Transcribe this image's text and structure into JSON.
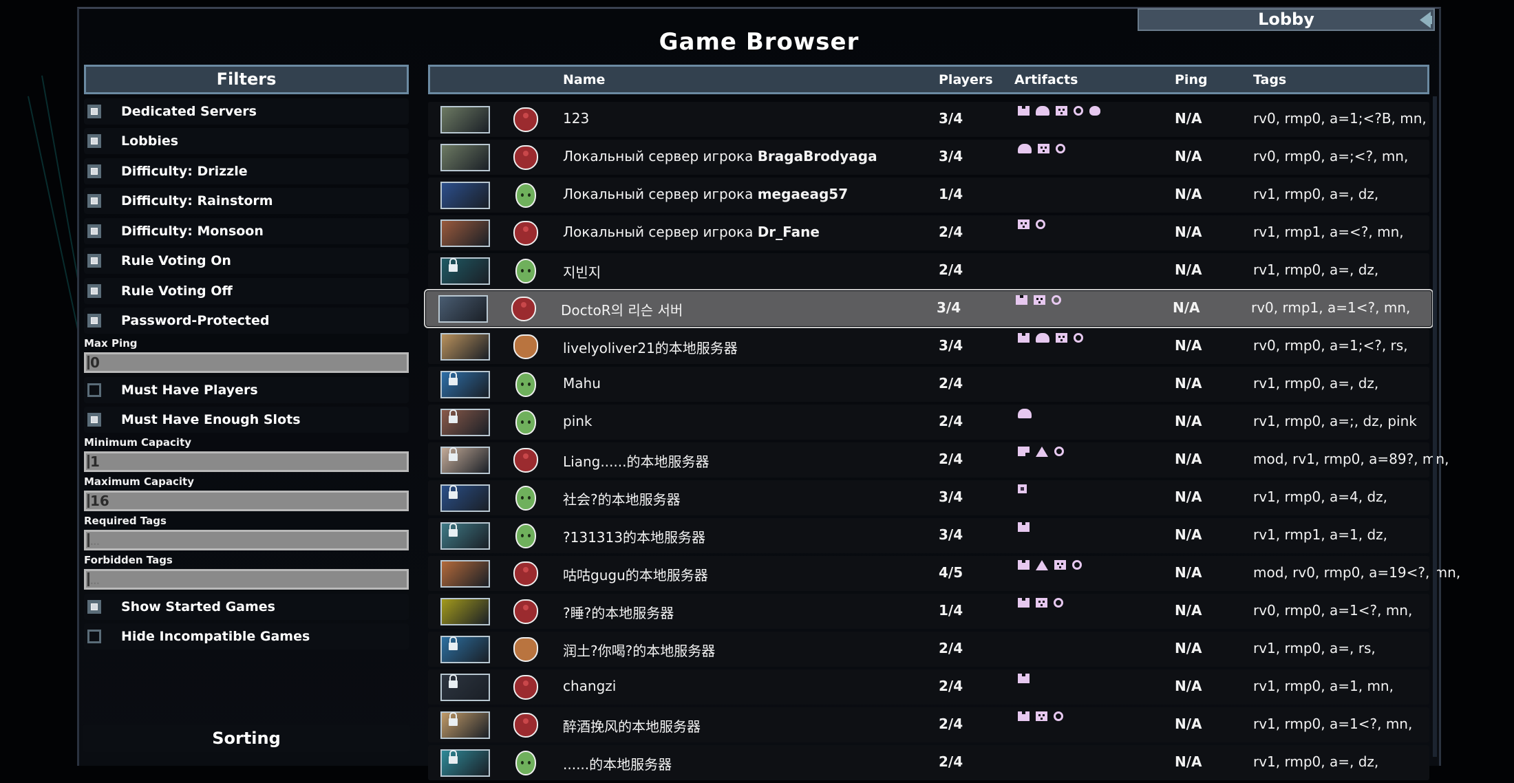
{
  "title": "Game Browser",
  "lobby_button": {
    "label": "Lobby",
    "icon": "back-arrow-icon"
  },
  "filters": {
    "header": "Filters",
    "checkboxes_top": [
      {
        "label": "Dedicated Servers",
        "checked": true
      },
      {
        "label": "Lobbies",
        "checked": true
      },
      {
        "label": "Difficulty: Drizzle",
        "checked": true
      },
      {
        "label": "Difficulty: Rainstorm",
        "checked": true
      },
      {
        "label": "Difficulty: Monsoon",
        "checked": true
      },
      {
        "label": "Rule Voting On",
        "checked": true
      },
      {
        "label": "Rule Voting Off",
        "checked": true
      },
      {
        "label": "Password-Protected",
        "checked": true
      }
    ],
    "max_ping": {
      "label": "Max Ping",
      "value": "0"
    },
    "checkboxes_mid": [
      {
        "label": "Must Have Players",
        "checked": false
      },
      {
        "label": "Must Have Enough Slots",
        "checked": true
      }
    ],
    "min_capacity": {
      "label": "Minimum Capacity",
      "value": "1"
    },
    "max_capacity": {
      "label": "Maximum Capacity",
      "value": "16"
    },
    "required_tags": {
      "label": "Required Tags",
      "placeholder": "..."
    },
    "forbidden_tags": {
      "label": "Forbidden Tags",
      "placeholder": "..."
    },
    "checkboxes_bottom": [
      {
        "label": "Show Started Games",
        "checked": true
      },
      {
        "label": "Hide Incompatible Games",
        "checked": false
      }
    ]
  },
  "sorting": {
    "header": "Sorting"
  },
  "table": {
    "columns": {
      "name": "Name",
      "players": "Players",
      "artifacts": "Artifacts",
      "ping": "Ping",
      "tags": "Tags"
    },
    "rows": [
      {
        "thumb": "#6d7a63",
        "locked": false,
        "survivor": "red",
        "name": "123",
        "name_bold": "",
        "players": "3/4",
        "artifacts": [
          "tower",
          "dome",
          "box",
          "ring",
          "cap"
        ],
        "ping": "N/A",
        "tags": "rv0, rmp0, a=1;<?B, mn,"
      },
      {
        "thumb": "#6d7a63",
        "locked": false,
        "survivor": "red",
        "name": "Локальный сервер игрока ",
        "name_bold": "BragaBrodyaga",
        "players": "3/4",
        "artifacts": [
          "dome",
          "box",
          "ring"
        ],
        "ping": "N/A",
        "tags": "rv0, rmp0, a=;<?, mn,"
      },
      {
        "thumb": "#2c4f8c",
        "locked": false,
        "survivor": "green",
        "name": "Локальный сервер игрока ",
        "name_bold": "megaeag57",
        "players": "1/4",
        "artifacts": [],
        "ping": "N/A",
        "tags": "rv1, rmp0, a=, dz,"
      },
      {
        "thumb": "#9a5a3c",
        "locked": false,
        "survivor": "red",
        "name": "Локальный сервер игрока ",
        "name_bold": "Dr_Fane",
        "players": "2/4",
        "artifacts": [
          "box",
          "ring"
        ],
        "ping": "N/A",
        "tags": "rv1, rmp1, a=<?, mn,"
      },
      {
        "thumb": "#1f5a64",
        "locked": true,
        "survivor": "green",
        "name": "지빈지",
        "name_bold": "",
        "players": "2/4",
        "artifacts": [],
        "ping": "N/A",
        "tags": "rv1, rmp0, a=, dz,"
      },
      {
        "thumb": "#4a5d72",
        "locked": false,
        "survivor": "red",
        "name": "DoctoR의 리슨 서버",
        "name_bold": "",
        "players": "3/4",
        "artifacts": [
          "tower",
          "box",
          "ring"
        ],
        "ping": "N/A",
        "tags": "rv0, rmp1, a=1<?, mn,",
        "selected": true
      },
      {
        "thumb": "#b9915c",
        "locked": false,
        "survivor": "brown",
        "name": "livelyoliver21的本地服务器",
        "name_bold": "",
        "players": "3/4",
        "artifacts": [
          "tower",
          "dome",
          "box",
          "ring"
        ],
        "ping": "N/A",
        "tags": "rv0, rmp0, a=1;<?, rs,"
      },
      {
        "thumb": "#2e6fa8",
        "locked": true,
        "survivor": "green",
        "name": "Mahu",
        "name_bold": "",
        "players": "2/4",
        "artifacts": [],
        "ping": "N/A",
        "tags": "rv1, rmp0, a=, dz,"
      },
      {
        "thumb": "#8a5a4a",
        "locked": true,
        "survivor": "green",
        "name": "pink",
        "name_bold": "",
        "players": "2/4",
        "artifacts": [
          "dome"
        ],
        "ping": "N/A",
        "tags": "rv1, rmp0, a=;, dz, pink"
      },
      {
        "thumb": "#c4ab98",
        "locked": true,
        "survivor": "red",
        "name": "Liang......的本地服务器",
        "name_bold": "",
        "players": "2/4",
        "artifacts": [
          "block",
          "tri",
          "ring"
        ],
        "ping": "N/A",
        "tags": "mod, rv1, rmp0, a=89?, mn,"
      },
      {
        "thumb": "#2a4f88",
        "locked": true,
        "survivor": "green",
        "name": "社会?的本地服务器",
        "name_bold": "",
        "players": "3/4",
        "artifacts": [
          "sq"
        ],
        "ping": "N/A",
        "tags": "rv1, rmp0, a=4, dz,"
      },
      {
        "thumb": "#3f7a86",
        "locked": true,
        "survivor": "green",
        "name": "?131313的本地服务器",
        "name_bold": "",
        "players": "3/4",
        "artifacts": [
          "tower"
        ],
        "ping": "N/A",
        "tags": "rv1, rmp1, a=1, dz,"
      },
      {
        "thumb": "#b46a3a",
        "locked": false,
        "survivor": "red",
        "name": "咕咕gugu的本地服务器",
        "name_bold": "",
        "players": "4/5",
        "artifacts": [
          "tower",
          "tri",
          "box",
          "ring"
        ],
        "ping": "N/A",
        "tags": "mod, rv0, rmp0, a=19<?, mn,"
      },
      {
        "thumb": "#a39a1c",
        "locked": false,
        "survivor": "red",
        "name": "?睡?的本地服务器",
        "name_bold": "",
        "players": "1/4",
        "artifacts": [
          "tower",
          "box",
          "ring"
        ],
        "ping": "N/A",
        "tags": "rv0, rmp0, a=1<?, mn,"
      },
      {
        "thumb": "#2c6fa0",
        "locked": true,
        "survivor": "brown",
        "name": "润土?你喝?的本地服务器",
        "name_bold": "",
        "players": "2/4",
        "artifacts": [],
        "ping": "N/A",
        "tags": "rv1, rmp0, a=, rs,"
      },
      {
        "thumb": "#2d3540",
        "locked": true,
        "survivor": "red",
        "name": "changzi",
        "name_bold": "",
        "players": "2/4",
        "artifacts": [
          "tower"
        ],
        "ping": "N/A",
        "tags": "rv1, rmp0, a=1, mn,"
      },
      {
        "thumb": "#c09a68",
        "locked": true,
        "survivor": "red",
        "name": "醉酒挽风的本地服务器",
        "name_bold": "",
        "players": "2/4",
        "artifacts": [
          "tower",
          "box",
          "ring"
        ],
        "ping": "N/A",
        "tags": "rv1, rmp0, a=1<?, mn,"
      },
      {
        "thumb": "#2f8a98",
        "locked": true,
        "survivor": "green",
        "name": "......的本地服务器",
        "name_bold": "",
        "players": "2/4",
        "artifacts": [],
        "ping": "N/A",
        "tags": "rv1, rmp0, a=, dz,"
      }
    ]
  }
}
